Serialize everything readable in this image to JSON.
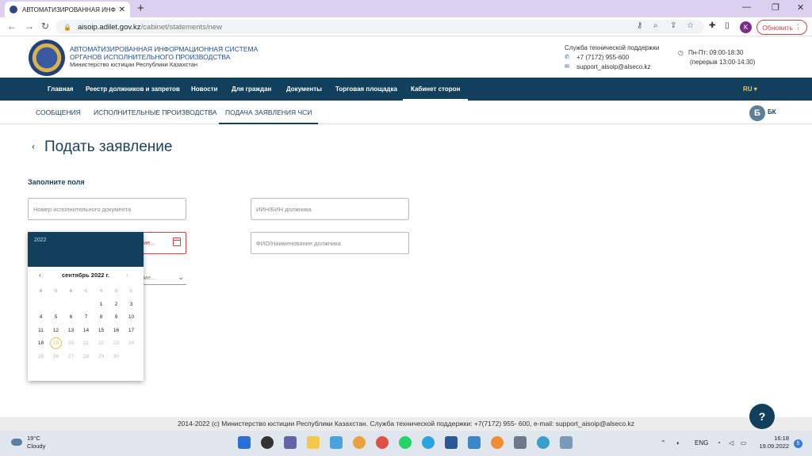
{
  "browser": {
    "tab_title": "АВТОМАТИЗИРОВАННАЯ ИНФ",
    "url_host": "aisoip.adilet.gov.kz",
    "url_path": "/cabinet/statements/new",
    "avatar_letter": "K",
    "update_label": "Обновить"
  },
  "header": {
    "org_line1": "АВТОМАТИЗИРОВАННАЯ ИНФОРМАЦИОННАЯ СИСТЕМА",
    "org_line2": "ОРГАНОВ ИСПОЛНИТЕЛЬНОГО ПРОИЗВОДСТВА",
    "org_line3": "Министерство юстиции Республики Казахстан",
    "support_title": "Служба технической поддержки",
    "support_phone": "+7 (7172) 955-600",
    "support_email": "support_aisoip@alseco.kz",
    "hours_line1": "Пн-Пт: 09:00-18:30",
    "hours_line2": "(перерыв 13:00-14:30)"
  },
  "nav": {
    "items": [
      "Главная",
      "Реестр должников и запретов",
      "Новости",
      "Для граждан",
      "Документы",
      "Торговая площадка",
      "Кабинет сторон"
    ],
    "lang": "RU ▾"
  },
  "subnav": {
    "items": [
      "СООБЩЕНИЯ",
      "ИСПОЛНИТЕЛЬНЫЕ ПРОИЗВОДСТВА",
      "ПОДАЧА ЗАЯВЛЕНИЯ ЧСИ"
    ],
    "user_badge": "Б",
    "user_initials": "БК"
  },
  "page": {
    "title": "Подать заявление",
    "fill_label": "Заполните поля",
    "doc_number_placeholder": "Номер исполнительного документа",
    "iin_placeholder": "ИИН/БИН должника",
    "fio_placeholder": "ФИО/Наименование должника",
    "date_field_visible_text": "ме...",
    "select_visible_text": "уме..."
  },
  "datepicker": {
    "year": "2022",
    "month_label": "сентябрь 2022 г.",
    "weekdays": [
      "в",
      "п",
      "в",
      "с",
      "ч",
      "п",
      "с"
    ],
    "weeks": [
      [
        "",
        "",
        "",
        "",
        "1",
        "2",
        "3"
      ],
      [
        "4",
        "5",
        "6",
        "7",
        "8",
        "9",
        "10"
      ],
      [
        "11",
        "12",
        "13",
        "14",
        "15",
        "16",
        "17"
      ],
      [
        "18",
        "19",
        "20",
        "21",
        "22",
        "23",
        "24"
      ],
      [
        "25",
        "26",
        "27",
        "28",
        "29",
        "30",
        ""
      ]
    ],
    "today": "19"
  },
  "footer": {
    "text": "2014-2022 (c) Министерство юстиции Республики Казахстан. Служба технической поддержки: +7(7172) 955- 600, e-mail: support_aisoip@alseco.kz"
  },
  "help_label": "?",
  "taskbar": {
    "temp": "19°C",
    "weather": "Cloudy",
    "lang": "ENG",
    "time": "16:18",
    "date": "19.09.2022",
    "notifications": "5"
  }
}
